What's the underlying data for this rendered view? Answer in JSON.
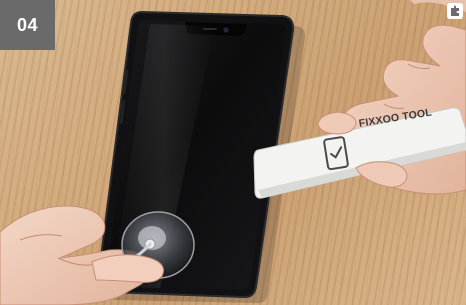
{
  "step": {
    "label": "04"
  },
  "tool": {
    "brand_text": "FIXXOO TOOL"
  },
  "icons": {
    "browser_extension": "puzzle-piece-icon",
    "tool_logo": "phone-check-icon"
  },
  "colors": {
    "badge_background": "#6a6a6a",
    "badge_text": "#ffffff",
    "phone_body": "#121212",
    "tool_body": "#f2f2f0",
    "wood": "#cfa678"
  }
}
